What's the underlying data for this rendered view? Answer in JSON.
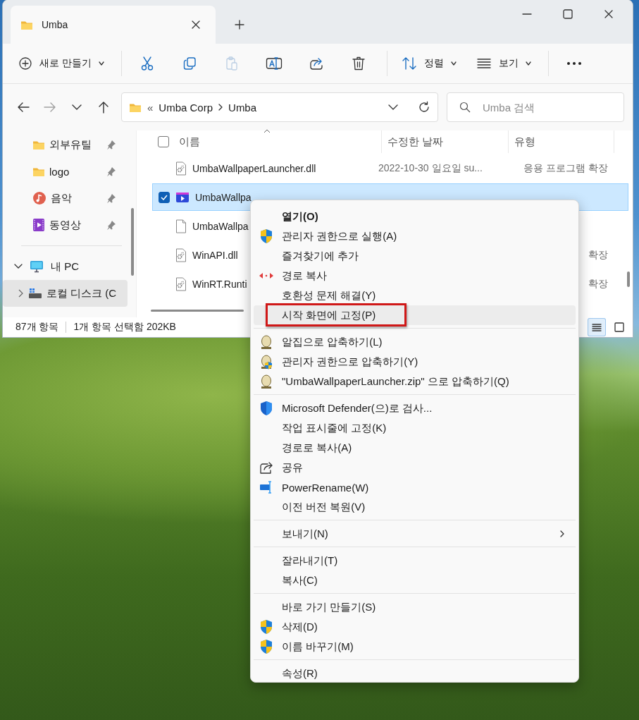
{
  "window": {
    "tabs": [
      {
        "label": "Umba",
        "selected": true
      }
    ],
    "toolbar": [
      {
        "kind": "new",
        "label": "새로 만들기",
        "disabled": false
      },
      {
        "kind": "cut",
        "disabled": false
      },
      {
        "kind": "copy",
        "disabled": false
      },
      {
        "kind": "paste",
        "disabled": true
      },
      {
        "kind": "rename",
        "disabled": false
      },
      {
        "kind": "share",
        "disabled": false
      },
      {
        "kind": "delete",
        "disabled": false
      },
      {
        "kind": "sort",
        "label": "정렬",
        "disabled": false
      },
      {
        "kind": "view",
        "label": "보기",
        "disabled": false
      },
      {
        "kind": "more",
        "disabled": false
      }
    ],
    "nav": [
      {
        "kind": "back",
        "disabled": false
      },
      {
        "kind": "forward",
        "disabled": true
      },
      {
        "kind": "recent",
        "disabled": false
      },
      {
        "kind": "up",
        "disabled": false
      }
    ],
    "address": {
      "overflow": "«",
      "path": [
        "Umba Corp",
        "Umba"
      ]
    },
    "search": {
      "placeholder": "Umba 검색"
    },
    "sidebar": {
      "items": [
        {
          "label": "외부유틸",
          "kind": "folder",
          "pinned": true,
          "selected": false
        },
        {
          "label": "logo",
          "kind": "folder",
          "pinned": true,
          "selected": false
        },
        {
          "label": "음악",
          "kind": "music",
          "pinned": true,
          "selected": false
        },
        {
          "label": "동영상",
          "kind": "video",
          "pinned": true,
          "selected": false
        },
        {
          "label": "내 PC",
          "kind": "pc",
          "pinned": false,
          "expanded": true,
          "selected": false
        },
        {
          "label": "로컬 디스크 (C",
          "kind": "drive",
          "pinned": false,
          "expanded": false,
          "selected": true
        }
      ]
    },
    "table": {
      "checked": false,
      "columns": [
        "이름",
        "수정한 날짜",
        "유형"
      ],
      "rows": [
        {
          "kind": "dll",
          "name": "UmbaWallpaperLauncher.dll",
          "date": "2022-10-30 일요일 su...",
          "type": "응용 프로그램 확장",
          "selected": false,
          "checked": false
        },
        {
          "kind": "exe",
          "name": "UmbaWallpa",
          "selected": true,
          "checked": true
        },
        {
          "kind": "file",
          "name": "UmbaWallpa",
          "selected": false,
          "checked": false
        },
        {
          "kind": "dll",
          "name": "WinAPI.dll",
          "type": "확장",
          "selected": false,
          "checked": false
        },
        {
          "kind": "dll",
          "name": "WinRT.Runti",
          "type": "확장",
          "selected": false,
          "checked": false
        }
      ]
    },
    "status_bar": {
      "count": "87개 항목",
      "selection": "1개 항목 선택함 202KB",
      "views": [
        {
          "kind": "details",
          "selected": true
        },
        {
          "kind": "tiles",
          "selected": false
        }
      ]
    }
  },
  "context_menu": {
    "groups": [
      [
        {
          "label": "열기(O)",
          "kind": "plain",
          "bold": true,
          "submenu": false,
          "selected": false,
          "outlined": false
        },
        {
          "label": "관리자 권한으로 실행(A)",
          "kind": "shield",
          "bold": false,
          "submenu": false,
          "selected": false,
          "outlined": false
        },
        {
          "label": "즐겨찾기에 추가",
          "kind": "plain",
          "bold": false,
          "submenu": false,
          "selected": false,
          "outlined": false
        },
        {
          "label": "경로 복사",
          "kind": "path-copy",
          "bold": false,
          "submenu": false,
          "selected": false,
          "outlined": false
        },
        {
          "label": "호환성 문제 해결(Y)",
          "kind": "plain",
          "bold": false,
          "submenu": false,
          "selected": false,
          "outlined": false
        },
        {
          "label": "시작 화면에 고정(P)",
          "kind": "plain",
          "bold": false,
          "submenu": false,
          "selected": true,
          "outlined": true
        }
      ],
      [
        {
          "label": "알집으로 압축하기(L)",
          "kind": "zip",
          "bold": false,
          "submenu": false,
          "selected": false,
          "outlined": false
        },
        {
          "label": "관리자 권한으로 압축하기(Y)",
          "kind": "zip-admin",
          "bold": false,
          "submenu": false,
          "selected": false,
          "outlined": false
        },
        {
          "label": "\"UmbaWallpaperLauncher.zip\" 으로 압축하기(Q)",
          "kind": "zip",
          "bold": false,
          "submenu": false,
          "selected": false,
          "outlined": false
        }
      ],
      [
        {
          "label": "Microsoft Defender(으)로 검사...",
          "kind": "defender",
          "bold": false,
          "submenu": false,
          "selected": false,
          "outlined": false
        },
        {
          "label": "작업 표시줄에 고정(K)",
          "kind": "plain",
          "bold": false,
          "submenu": false,
          "selected": false,
          "outlined": false
        },
        {
          "label": "경로로 복사(A)",
          "kind": "plain",
          "bold": false,
          "submenu": false,
          "selected": false,
          "outlined": false
        },
        {
          "label": "공유",
          "kind": "share",
          "bold": false,
          "submenu": false,
          "selected": false,
          "outlined": false
        },
        {
          "label": "PowerRename(W)",
          "kind": "powerrename",
          "bold": false,
          "submenu": false,
          "selected": false,
          "outlined": false
        },
        {
          "label": "이전 버전 복원(V)",
          "kind": "plain",
          "bold": false,
          "submenu": false,
          "selected": false,
          "outlined": false
        }
      ],
      [
        {
          "label": "보내기(N)",
          "kind": "plain",
          "bold": false,
          "submenu": true,
          "selected": false,
          "outlined": false
        }
      ],
      [
        {
          "label": "잘라내기(T)",
          "kind": "plain",
          "bold": false,
          "submenu": false,
          "selected": false,
          "outlined": false
        },
        {
          "label": "복사(C)",
          "kind": "plain",
          "bold": false,
          "submenu": false,
          "selected": false,
          "outlined": false
        }
      ],
      [
        {
          "label": "바로 가기 만들기(S)",
          "kind": "plain",
          "bold": false,
          "submenu": false,
          "selected": false,
          "outlined": false
        },
        {
          "label": "삭제(D)",
          "kind": "shield",
          "bold": false,
          "submenu": false,
          "selected": false,
          "outlined": false
        },
        {
          "label": "이름 바꾸기(M)",
          "kind": "shield",
          "bold": false,
          "submenu": false,
          "selected": false,
          "outlined": false
        }
      ],
      [
        {
          "label": "속성(R)",
          "kind": "plain",
          "bold": false,
          "submenu": false,
          "selected": false,
          "outlined": false
        }
      ]
    ]
  }
}
